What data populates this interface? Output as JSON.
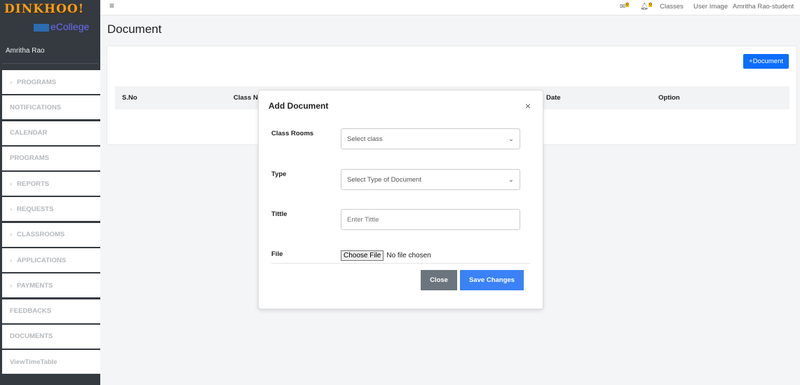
{
  "sidebar": {
    "logo": "DINKHOO!",
    "sublogo": "eCollege",
    "user": "Amritha Rao",
    "items": [
      {
        "label": "PROGRAMS",
        "chevron": true
      },
      {
        "label": "NOTIFICATIONS"
      },
      {
        "label": "CALENDAR"
      },
      {
        "label": "PROGRAMS"
      },
      {
        "label": "REPORTS",
        "chevron": true
      },
      {
        "label": "REQUESTS",
        "chevron": true
      },
      {
        "label": "CLASSROOMS",
        "chevron": true
      },
      {
        "label": "APPLICATIONS",
        "chevron": true
      },
      {
        "label": "PAYMENTS",
        "chevron": true
      },
      {
        "label": "FEEDBACKS"
      },
      {
        "label": "DOCUMENTS"
      },
      {
        "label": "ViewTimeTable"
      }
    ]
  },
  "topbar": {
    "mail_count": "0",
    "bell_count": "0",
    "classes": "Classes",
    "user_image": "User Image",
    "user": "Amritha Rao-student"
  },
  "page": {
    "title": "Document",
    "add_button": "+Document",
    "columns": [
      "S.No",
      "Class N",
      "Date",
      "Option"
    ]
  },
  "modal": {
    "title": "Add Document",
    "close_x": "×",
    "class_label": "Class Rooms",
    "class_value": "Select class",
    "type_label": "Type",
    "type_value": "Select Type of Document",
    "title_label": "Tittle",
    "title_placeholder": "Enter Tittle",
    "file_label": "File",
    "file_button": "Choose File",
    "file_status": "No file chosen",
    "close_button": "Close",
    "save_button": "Save Changes"
  },
  "colors": {
    "primary": "#0d6efd",
    "sidebar": "#343a40",
    "secondary": "#6c757d"
  }
}
